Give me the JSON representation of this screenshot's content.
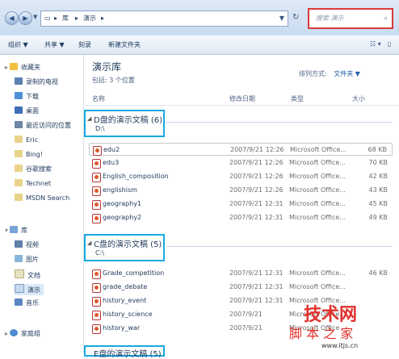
{
  "address": {
    "crumbs": [
      "库",
      "演示"
    ],
    "search_placeholder": "搜索 演示"
  },
  "toolbar": {
    "organize": "组织 ▼",
    "share": "共享 ▼",
    "burn": "刻录",
    "new_folder": "新建文件夹"
  },
  "nav": {
    "favorites": "收藏夹",
    "favorites_items": [
      "录制的电视",
      "下载",
      "桌面",
      "最近访问的位置",
      "Eric",
      "Bing!",
      "谷歌搜索",
      "Technet",
      "MSDN  Search"
    ],
    "libraries": "库",
    "library_items": [
      "视频",
      "图片",
      "文档",
      "演示",
      "音乐"
    ],
    "homegroup": "家庭组"
  },
  "library": {
    "title": "演示库",
    "includes": "包括: 3 个位置",
    "arrange_by_label": "排列方式:",
    "arrange_by_value": "文件夹 ▼"
  },
  "columns": {
    "name": "名称",
    "date": "修改日期",
    "type": "类型",
    "size": "大小"
  },
  "groups": [
    {
      "title": "D盘的演示文稿 (6)",
      "path": "D:\\",
      "files": [
        {
          "name": "edu2",
          "date": "2007/9/21 12:26",
          "type": "Microsoft Office...",
          "size": "68 KB"
        },
        {
          "name": "edu3",
          "date": "2007/9/21 12:26",
          "type": "Microsoft Office...",
          "size": "70 KB"
        },
        {
          "name": "English_composition",
          "date": "2007/9/21 12:26",
          "type": "Microsoft Office...",
          "size": "42 KB"
        },
        {
          "name": "englishism",
          "date": "2007/9/21 12:26",
          "type": "Microsoft Office...",
          "size": "43 KB"
        },
        {
          "name": "geography1",
          "date": "2007/9/21 12:31",
          "type": "Microsoft Office...",
          "size": "45 KB"
        },
        {
          "name": "geography2",
          "date": "2007/9/21 12:31",
          "type": "Microsoft Office...",
          "size": "49 KB"
        }
      ]
    },
    {
      "title": "C盘的演示文稿 (5)",
      "path": "C:\\",
      "files": [
        {
          "name": "Grade_competition",
          "date": "2007/9/21 12:31",
          "type": "Microsoft Office...",
          "size": "46 KB"
        },
        {
          "name": "grade_debate",
          "date": "2007/9/21 12:31",
          "type": "Microsoft Office...",
          "size": ""
        },
        {
          "name": "history_event",
          "date": "2007/9/21 12:31",
          "type": "Microsoft Office...",
          "size": ""
        },
        {
          "name": "history_science",
          "date": "2007/9/21",
          "type": "Microsoft Office...",
          "size": ""
        },
        {
          "name": "history_war",
          "date": "2007/9/21",
          "type": "Microsoft Office",
          "size": ""
        }
      ]
    },
    {
      "title": "E盘的演示文稿 (5)",
      "path": "",
      "files": []
    }
  ],
  "watermark": {
    "brand": "技术网",
    "sub": "脚 本 之 家",
    "url": "www.itjs.cn"
  },
  "colors": {
    "highlight": "#19a9e1",
    "search_border": "#d83a3a",
    "watermark": "#e0312d"
  }
}
